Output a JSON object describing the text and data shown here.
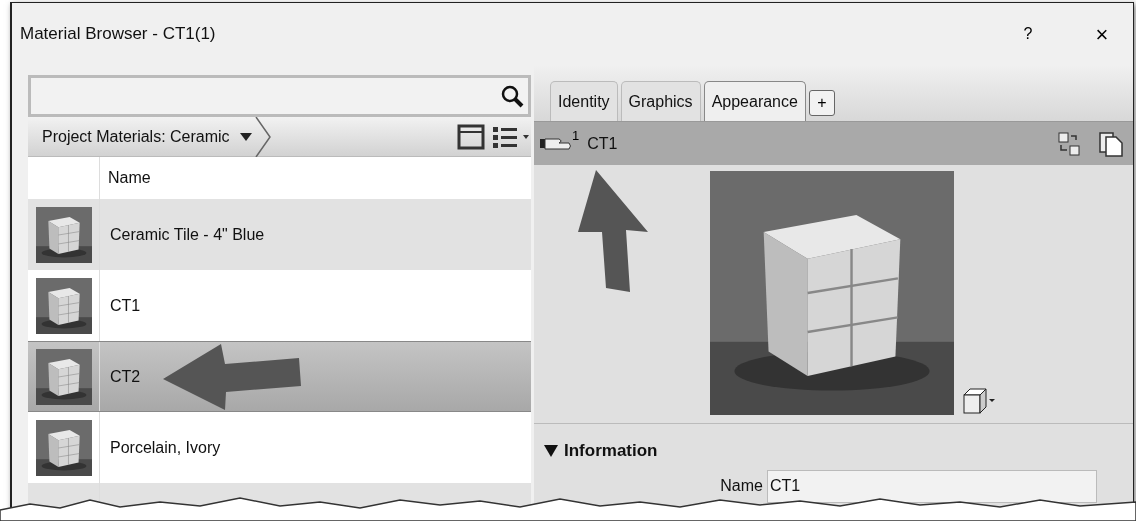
{
  "window": {
    "title": "Material Browser - CT1(1)",
    "help": "?",
    "close": "×"
  },
  "browser": {
    "breadcrumb": "Project Materials: Ceramic",
    "columns": [
      "Name"
    ],
    "rows": [
      {
        "name": "Ceramic Tile - 4\" Blue",
        "selected": false
      },
      {
        "name": "CT1",
        "selected": false
      },
      {
        "name": "CT2",
        "selected": true
      },
      {
        "name": "Porcelain, Ivory",
        "selected": false
      }
    ]
  },
  "editor": {
    "tabs": [
      {
        "label": "Identity",
        "selected": false
      },
      {
        "label": "Graphics",
        "selected": false
      },
      {
        "label": "Appearance",
        "selected": true
      }
    ],
    "add_tab": "+",
    "asset": {
      "count": "1",
      "name": "CT1"
    },
    "section": {
      "title": "Information",
      "expanded": true,
      "fields": [
        {
          "label": "Name",
          "value": "CT1"
        }
      ]
    }
  }
}
